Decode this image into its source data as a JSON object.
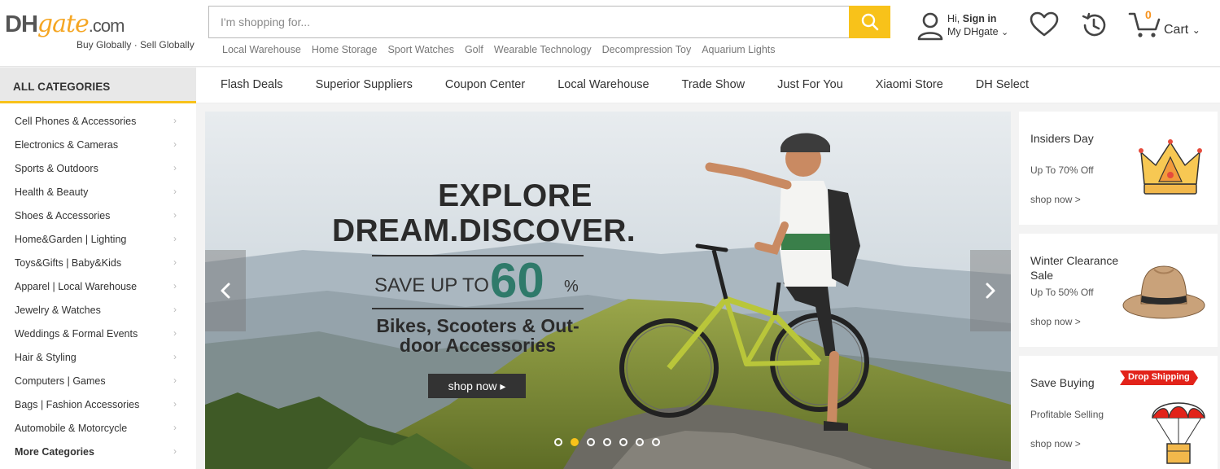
{
  "logo": {
    "dh": "DH",
    "gate": "gate",
    "com": ".com",
    "tagline": "Buy Globally · Sell Globally"
  },
  "search": {
    "placeholder": "I'm shopping for..."
  },
  "hot_words": [
    "Local Warehouse",
    "Home Storage",
    "Sport Watches",
    "Golf",
    "Wearable Technology",
    "Decompression Toy",
    "Aquarium Lights"
  ],
  "account": {
    "greeting": "Hi,",
    "sign_in": "Sign in",
    "my": "My DHgate"
  },
  "cart": {
    "count": "0",
    "label": "Cart"
  },
  "nav": {
    "all_categories": "ALL CATEGORIES",
    "links": [
      "Flash Deals",
      "Superior Suppliers",
      "Coupon Center",
      "Local Warehouse",
      "Trade Show",
      "Just For You",
      "Xiaomi Store",
      "DH Select"
    ]
  },
  "categories": [
    "Cell Phones & Accessories",
    "Electronics & Cameras",
    "Sports & Outdoors",
    "Health & Beauty",
    "Shoes & Accessories",
    "Home&Garden  |  Lighting",
    "Toys&Gifts  |  Baby&Kids",
    "Apparel  |  Local Warehouse",
    "Jewelry & Watches",
    "Weddings & Formal Events",
    "Hair & Styling",
    "Computers  |  Games",
    "Bags  |  Fashion Accessories",
    "Automobile & Motorcycle",
    "More Categories"
  ],
  "banner": {
    "title1": "EXPLORE",
    "title2": "DREAM.DISCOVER.",
    "save_text": "SAVE UP TO",
    "save_value": "60",
    "save_unit": "%",
    "subtitle": "Bikes, Scooters & Out-door Accessories",
    "cta": "shop now ▸",
    "slides": 7,
    "active_slide": 2
  },
  "promos": [
    {
      "title": "Insiders Day",
      "sub": "Up To 70% Off",
      "link": "shop now >",
      "icon": "crown-icon"
    },
    {
      "title": "Winter Clearance Sale",
      "sub": "Up To 50% Off",
      "link": "shop now >",
      "icon": "hat-icon"
    },
    {
      "title": "Save Buying",
      "sub": "Profitable Selling",
      "link": "shop now >",
      "icon": "parachute-box-icon",
      "badge": "Drop Shipping"
    }
  ],
  "colors": {
    "accent": "#f8c21a",
    "brand_orange": "#f7931e",
    "banner_green": "#2f7a6a"
  }
}
